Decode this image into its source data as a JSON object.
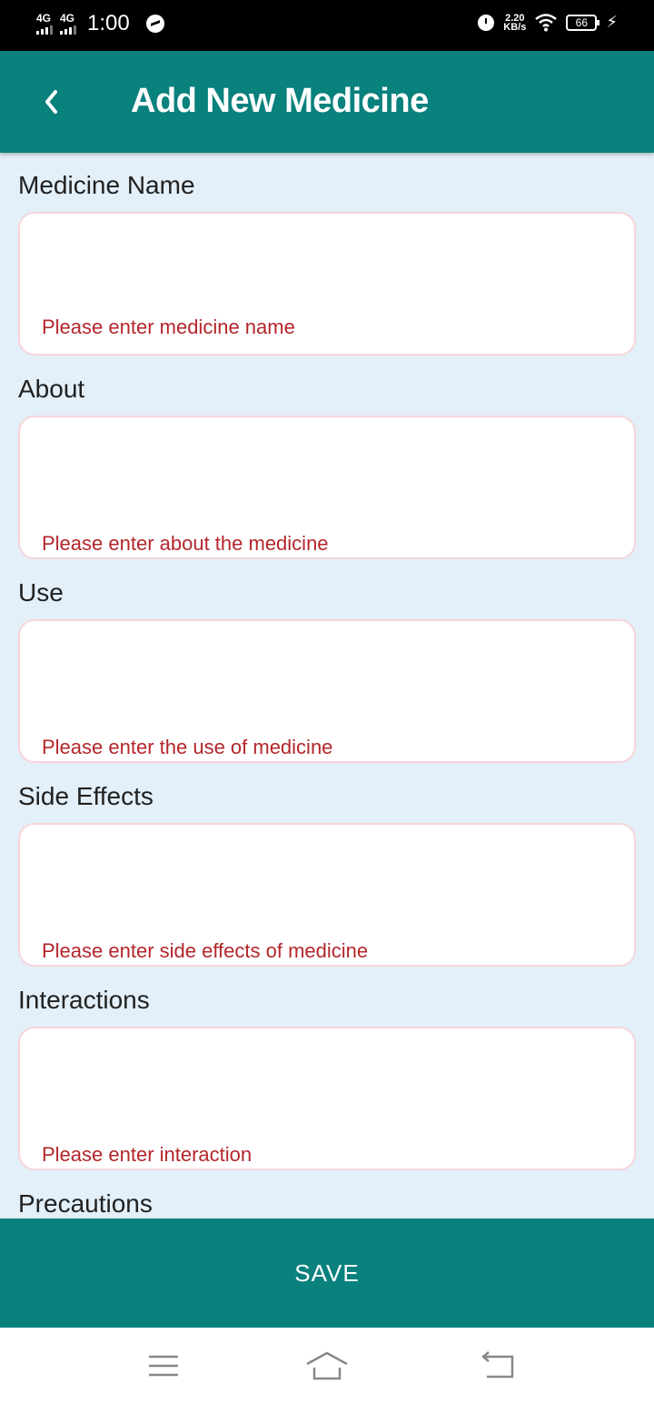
{
  "status_bar": {
    "net1": "4G",
    "net2": "4G",
    "time": "1:00",
    "speed_value": "2.20",
    "speed_unit": "KB/s",
    "battery": "66"
  },
  "app_bar": {
    "title": "Add New Medicine",
    "back_icon": "chevron-left-icon"
  },
  "form": {
    "fields": [
      {
        "label": "Medicine Name",
        "error": "Please enter medicine name"
      },
      {
        "label": "About",
        "error": "Please enter about the medicine"
      },
      {
        "label": "Use",
        "error": "Please enter the use of medicine"
      },
      {
        "label": "Side Effects",
        "error": "Please enter side effects of medicine"
      },
      {
        "label": "Interactions",
        "error": "Please enter interaction"
      },
      {
        "label": "Precautions"
      }
    ]
  },
  "save_label": "SAVE",
  "colors": {
    "accent": "#09817d",
    "background": "#e3eff9",
    "error": "#b3262b",
    "field_border": "#f6d6da"
  },
  "nav": {
    "icons": [
      "menu-icon",
      "home-icon",
      "back-icon"
    ]
  }
}
